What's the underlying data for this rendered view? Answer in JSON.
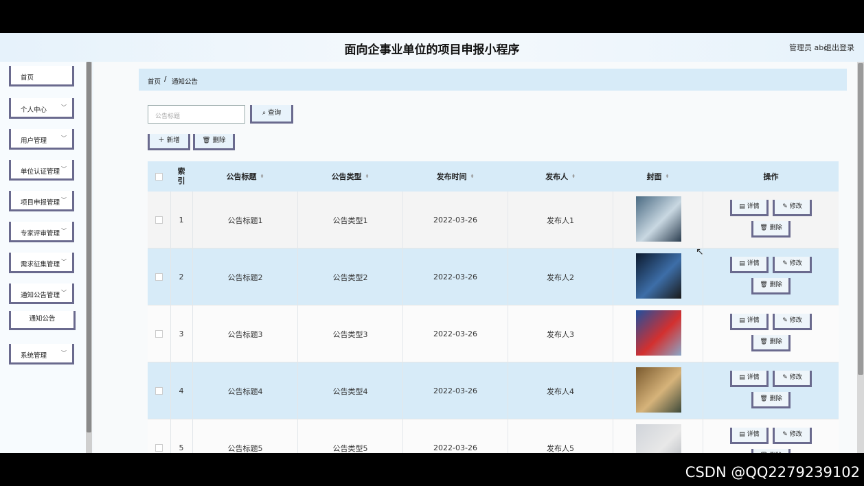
{
  "header": {
    "title": "面向企事业单位的项目申报小程序",
    "user": "管理员 abo",
    "logout": "退出登录"
  },
  "sidebar": {
    "items": [
      {
        "label": "首页"
      },
      {
        "label": "个人中心"
      },
      {
        "label": "用户管理"
      },
      {
        "label": "单位认证管理"
      },
      {
        "label": "项目申报管理"
      },
      {
        "label": "专家评审管理"
      },
      {
        "label": "需求征集管理"
      },
      {
        "label": "通知公告管理"
      },
      {
        "label": "通知公告"
      },
      {
        "label": "系统管理"
      }
    ]
  },
  "breadcrumb": {
    "home": "首页",
    "separator": "/",
    "current": "通知公告"
  },
  "search": {
    "placeholder": "公告标题",
    "button": "查询"
  },
  "toolbar": {
    "add": "新增",
    "delete": "删除"
  },
  "table": {
    "headers": {
      "index": "索引",
      "title": "公告标题",
      "type": "公告类型",
      "time": "发布时间",
      "publisher": "发布人",
      "cover": "封面",
      "actions": "操作"
    },
    "rows": [
      {
        "index": "1",
        "title": "公告标题1",
        "type": "公告类型1",
        "time": "2022-03-26",
        "publisher": "发布人1"
      },
      {
        "index": "2",
        "title": "公告标题2",
        "type": "公告类型2",
        "time": "2022-03-26",
        "publisher": "发布人2"
      },
      {
        "index": "3",
        "title": "公告标题3",
        "type": "公告类型3",
        "time": "2022-03-26",
        "publisher": "发布人3"
      },
      {
        "index": "4",
        "title": "公告标题4",
        "type": "公告类型4",
        "time": "2022-03-26",
        "publisher": "发布人4"
      },
      {
        "index": "5",
        "title": "公告标题5",
        "type": "公告类型5",
        "time": "2022-03-26",
        "publisher": "发布人5"
      }
    ],
    "actions": {
      "detail": "详情",
      "edit": "修改",
      "delete": "删除"
    }
  },
  "watermark": "CSDN @QQ2279239102",
  "icons": {
    "search": "search-icon",
    "plus": "plus-icon",
    "trash": "trash-icon",
    "detail": "document-icon",
    "edit": "pencil-icon",
    "chevron": "chevron-down-icon"
  },
  "colors": {
    "accent_border": "#6a6a8e",
    "header_bg": "#d7ebf8"
  }
}
